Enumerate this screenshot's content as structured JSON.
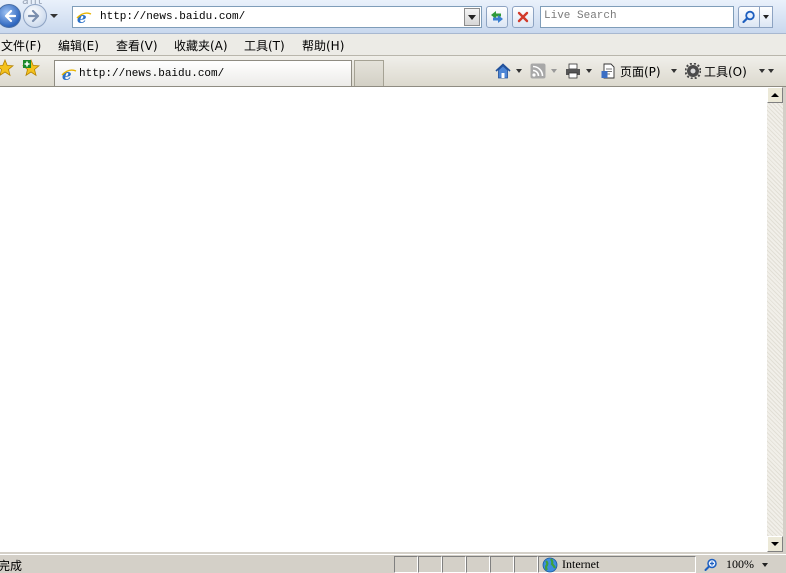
{
  "window": {
    "ghost_title": "ailt",
    "address": "http://news.baidu.com/",
    "search_placeholder": "Live Search"
  },
  "menu": [
    {
      "label": "文件(F)"
    },
    {
      "label": "编辑(E)"
    },
    {
      "label": "查看(V)"
    },
    {
      "label": "收藏夹(A)"
    },
    {
      "label": "工具(T)"
    },
    {
      "label": "帮助(H)"
    }
  ],
  "tabs": {
    "active_title": "http://news.baidu.com/"
  },
  "commands": {
    "page_label": "页面(P)",
    "tools_label": "工具(O)"
  },
  "status": {
    "text": "完成",
    "zone": "Internet",
    "zoom": "100%"
  },
  "icons": [
    "back-icon",
    "forward-icon",
    "ie-page-icon",
    "refresh-icon",
    "stop-icon",
    "search-icon",
    "favorites-star-icon",
    "add-favorite-icon",
    "home-icon",
    "feeds-icon",
    "print-icon",
    "page-icon",
    "tools-gear-icon",
    "globe-icon",
    "zoom-icon"
  ],
  "colors": {
    "chrome_blue": "#c9d8ee",
    "face": "#d4d0c8",
    "stop_red": "#d23a2a",
    "refresh_green": "#2f9a3a"
  }
}
